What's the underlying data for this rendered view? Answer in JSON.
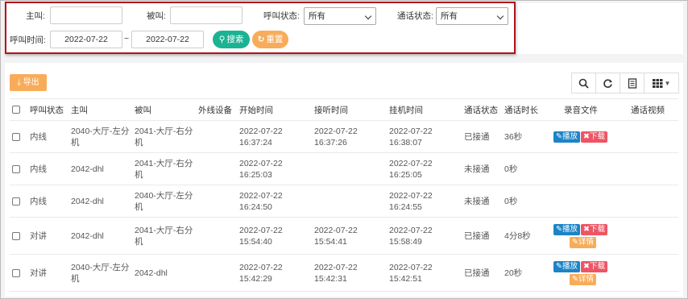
{
  "search": {
    "caller_label": "主叫:",
    "callee_label": "被叫:",
    "call_status_label": "呼叫状态:",
    "call_status_value": "所有",
    "talk_status_label": "通话状态:",
    "talk_status_value": "所有",
    "time_label": "呼叫时间:",
    "start_date": "2022-07-22",
    "range_sep": "~",
    "end_date": "2022-07-22",
    "search_button": "搜索",
    "reset_button": "重置"
  },
  "toolbar": {
    "export_label": "导出",
    "icons": [
      "search-icon",
      "refresh-icon",
      "columns-icon",
      "grid-menu-icon"
    ]
  },
  "table": {
    "headers": [
      "呼叫状态",
      "主叫",
      "被叫",
      "外线设备",
      "开始时间",
      "接听时间",
      "挂机时间",
      "通话状态",
      "通话时长",
      "录音文件",
      "通话视频"
    ],
    "rows": [
      {
        "call_status": "内线",
        "caller": "2040-大厅-左分机",
        "callee": "2041-大厅-右分机",
        "line": "",
        "start": "2022-07-22 16:37:24",
        "answer": "2022-07-22 16:37:26",
        "hangup": "2022-07-22 16:38:07",
        "talk_status": "已接通",
        "duration": "36秒",
        "actions": [
          "播放",
          "下载"
        ]
      },
      {
        "call_status": "内线",
        "caller": "2042-dhl",
        "callee": "2041-大厅-右分机",
        "line": "",
        "start": "2022-07-22 16:25:03",
        "answer": "",
        "hangup": "2022-07-22 16:25:05",
        "talk_status": "未接通",
        "duration": "0秒",
        "actions": []
      },
      {
        "call_status": "内线",
        "caller": "2042-dhl",
        "callee": "2040-大厅-左分机",
        "line": "",
        "start": "2022-07-22 16:24:50",
        "answer": "",
        "hangup": "2022-07-22 16:24:55",
        "talk_status": "未接通",
        "duration": "0秒",
        "actions": []
      },
      {
        "call_status": "对讲",
        "caller": "2042-dhl",
        "callee": "2041-大厅-右分机",
        "line": "",
        "start": "2022-07-22 15:54:40",
        "answer": "2022-07-22 15:54:41",
        "hangup": "2022-07-22 15:58:49",
        "talk_status": "已接通",
        "duration": "4分8秒",
        "actions": [
          "播放",
          "下载",
          "详情"
        ]
      },
      {
        "call_status": "对讲",
        "caller": "2040-大厅-左分机",
        "callee": "2042-dhl",
        "line": "",
        "start": "2022-07-22 15:42:29",
        "answer": "2022-07-22 15:42:31",
        "hangup": "2022-07-22 15:42:51",
        "talk_status": "已接通",
        "duration": "20秒",
        "actions": [
          "播放",
          "下载",
          "详情"
        ]
      }
    ]
  },
  "colors": {
    "accent_green": "#1ab394",
    "accent_orange": "#f8ac59",
    "play_blue": "#1c84c6",
    "download_red": "#ed5565",
    "highlight_border": "#b3141b"
  }
}
